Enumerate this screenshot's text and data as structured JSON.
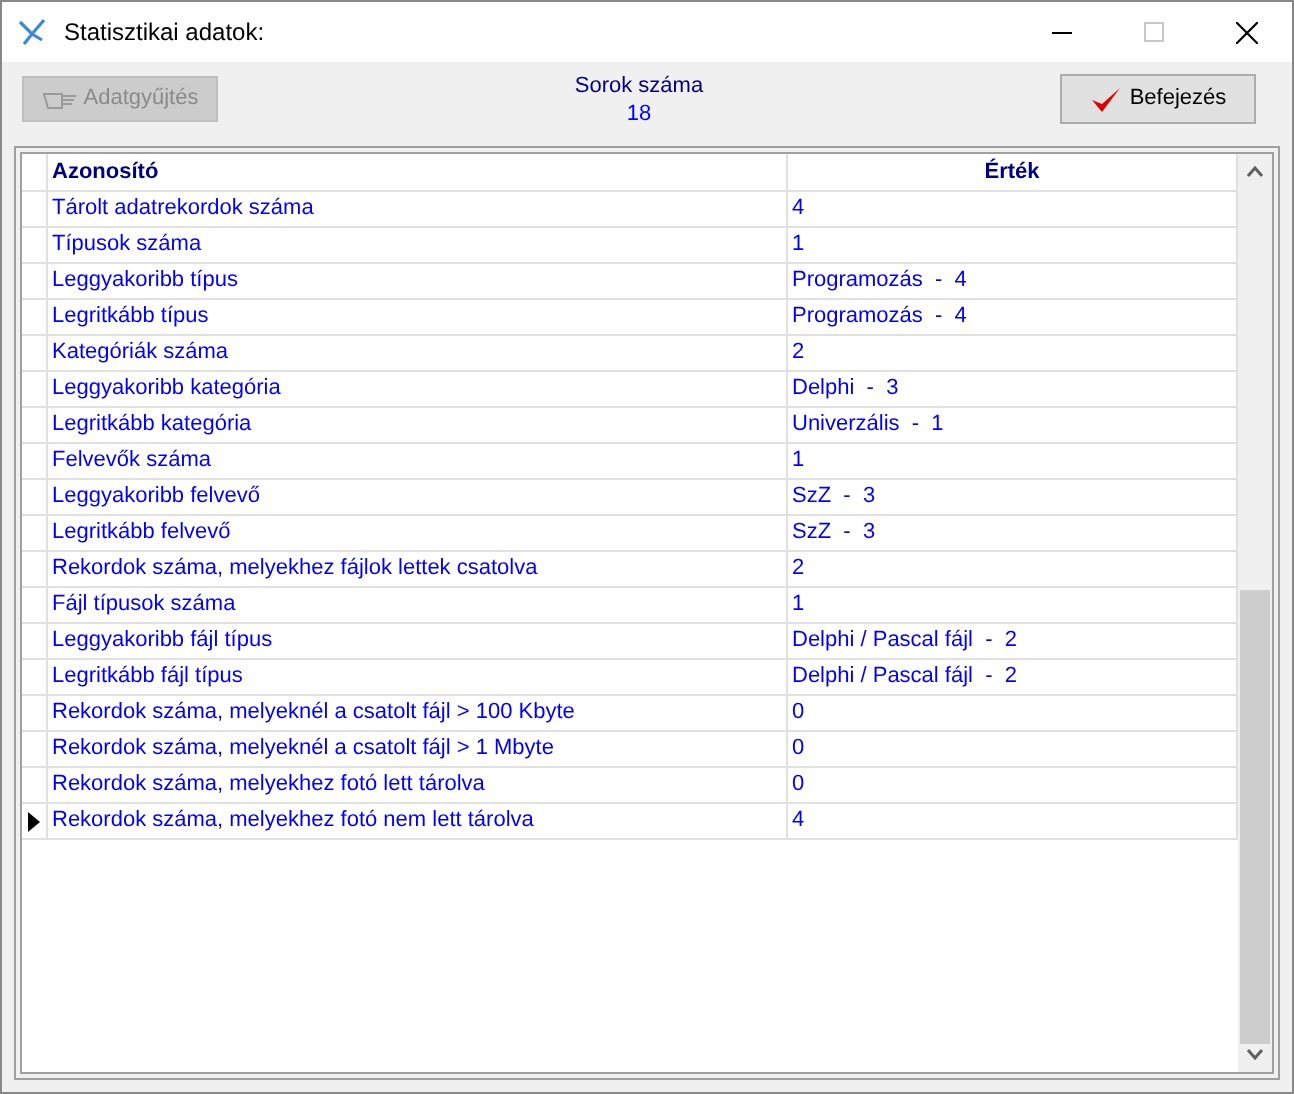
{
  "window": {
    "title": "Statisztikai adatok:",
    "maximize_disabled": true
  },
  "toolbar": {
    "collect_button": {
      "label": "Adatgyűjtés",
      "disabled": true
    },
    "row_count_label": "Sorok száma",
    "row_count": "18",
    "finish_button": {
      "label": "Befejezés",
      "disabled": false
    }
  },
  "table": {
    "columns": [
      "Azonosító",
      "Érték"
    ],
    "rows": [
      {
        "name": "Tárolt adatrekordok száma",
        "value": "4",
        "selected": false
      },
      {
        "name": "Típusok száma",
        "value": "1",
        "selected": false
      },
      {
        "name": "Leggyakoribb típus",
        "value": "Programozás  -  4",
        "selected": false
      },
      {
        "name": "Legritkább típus",
        "value": "Programozás  -  4",
        "selected": false
      },
      {
        "name": "Kategóriák száma",
        "value": "2",
        "selected": false
      },
      {
        "name": "Leggyakoribb kategória",
        "value": "Delphi  -  3",
        "selected": false
      },
      {
        "name": "Legritkább kategória",
        "value": "Univerzális  -  1",
        "selected": false
      },
      {
        "name": "Felvevők száma",
        "value": "1",
        "selected": false
      },
      {
        "name": "Leggyakoribb felvevő",
        "value": "SzZ  -  3",
        "selected": false
      },
      {
        "name": "Legritkább felvevő",
        "value": "SzZ  -  3",
        "selected": false
      },
      {
        "name": "Rekordok száma, melyekhez fájlok lettek csatolva",
        "value": "2",
        "selected": false
      },
      {
        "name": "Fájl típusok száma",
        "value": "1",
        "selected": false
      },
      {
        "name": "Leggyakoribb fájl típus",
        "value": "Delphi / Pascal fájl  -  2",
        "selected": false
      },
      {
        "name": "Legritkább fájl típus",
        "value": "Delphi / Pascal fájl  -  2",
        "selected": false
      },
      {
        "name": "Rekordok száma, melyeknél a csatolt fájl > 100 Kbyte",
        "value": "0",
        "selected": false
      },
      {
        "name": "Rekordok száma, melyeknél a csatolt fájl > 1 Mbyte",
        "value": "0",
        "selected": false
      },
      {
        "name": "Rekordok száma, melyekhez fotó lett tárolva",
        "value": "0",
        "selected": false
      },
      {
        "name": "Rekordok száma, melyekhez fotó nem lett tárolva",
        "value": "4",
        "selected": true
      }
    ]
  }
}
